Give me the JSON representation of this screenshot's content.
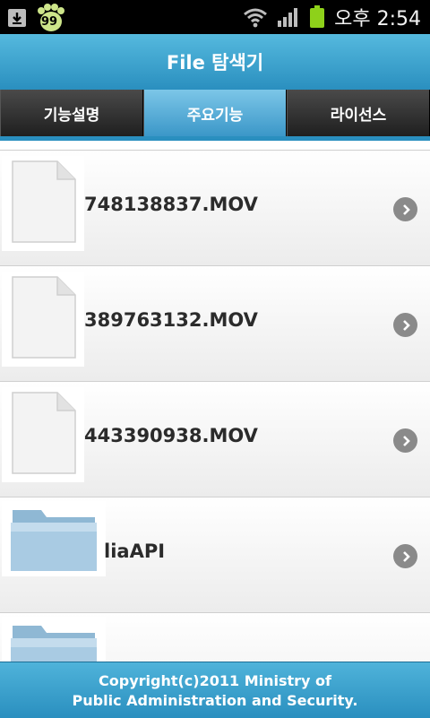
{
  "status_bar": {
    "time": "오후 2:54",
    "badge": "99"
  },
  "app": {
    "title": "File 탐색기"
  },
  "tabs": [
    {
      "label": "기능설명"
    },
    {
      "label": "주요기능"
    },
    {
      "label": "라이선스"
    }
  ],
  "files": [
    {
      "name": "748138837.MOV",
      "icon": "document-icon"
    },
    {
      "name": "389763132.MOV",
      "icon": "document-icon"
    },
    {
      "name": "443390938.MOV",
      "icon": "document-icon"
    },
    {
      "name": "liaAPI",
      "icon": "folder-icon"
    }
  ],
  "footer": {
    "line1": "Copyright(c)2011 Ministry of",
    "line2": "Public Administration and Security."
  },
  "colors": {
    "accent": "#2a8fbf",
    "active_tab": "#5aaed8"
  }
}
